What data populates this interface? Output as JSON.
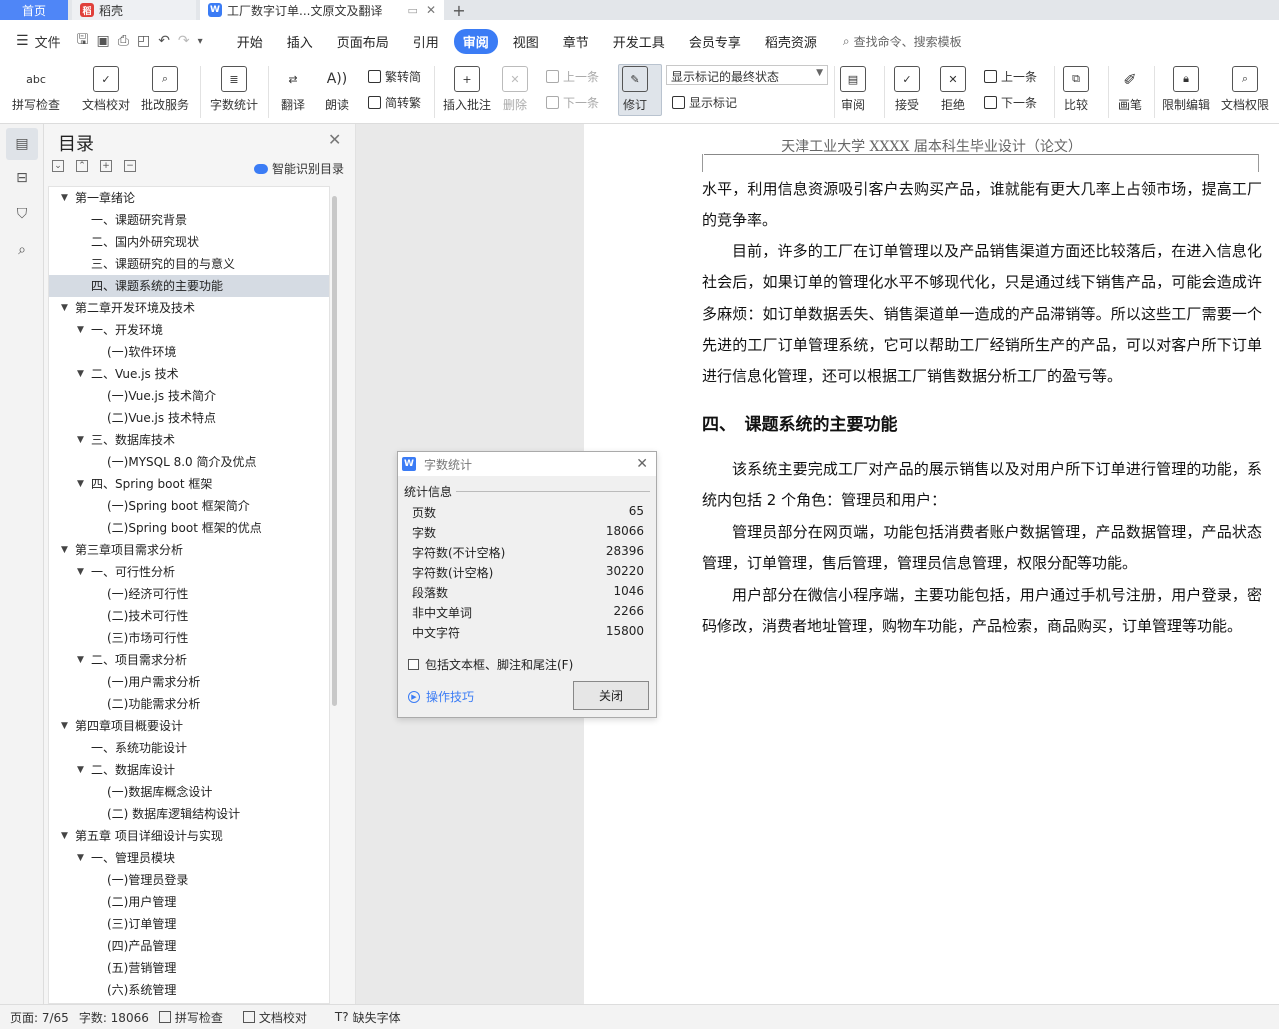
{
  "tabs": {
    "home": "首页",
    "daoke": "稻壳",
    "doc": "工厂数字订单...文原文及翻译"
  },
  "menubar": {
    "file": "文件",
    "items": [
      "开始",
      "插入",
      "页面布局",
      "引用",
      "审阅",
      "视图",
      "章节",
      "开发工具",
      "会员专享",
      "稻壳资源"
    ],
    "active": "审阅",
    "search": "查找命令、搜索模板"
  },
  "ribbon": {
    "spell": "拼写检查",
    "doc_check": "文档校对",
    "batch": "批改服务",
    "word_count": "字数统计",
    "translate": "翻译",
    "read": "朗读",
    "trad": "繁转简",
    "simp": "简转繁",
    "insert_comment": "插入批注",
    "delete": "删除",
    "prev": "上一条",
    "next": "下一条",
    "revise": "修订",
    "display_combo": "显示标记的最终状态",
    "show_marks": "显示标记",
    "review": "审阅",
    "accept": "接受",
    "reject": "拒绝",
    "prev2": "上一条",
    "next2": "下一条",
    "compare": "比较",
    "pen": "画笔",
    "restrict": "限制编辑",
    "perm": "文档权限"
  },
  "toc": {
    "title": "目录",
    "smart": "智能识别目录",
    "items": [
      {
        "text": "第一章绪论",
        "level": 0,
        "caret": true
      },
      {
        "text": "一、课题研究背景",
        "level": 1,
        "caret": false
      },
      {
        "text": "二、国内外研究现状",
        "level": 1,
        "caret": false
      },
      {
        "text": "三、课题研究的目的与意义",
        "level": 1,
        "caret": false
      },
      {
        "text": "四、课题系统的主要功能",
        "level": 1,
        "caret": false,
        "selected": true
      },
      {
        "text": "第二章开发环境及技术",
        "level": 0,
        "caret": true
      },
      {
        "text": "一、开发环境",
        "level": 1,
        "caret": true
      },
      {
        "text": "(一)软件环境",
        "level": 2,
        "caret": false
      },
      {
        "text": "二、Vue.js 技术",
        "level": 1,
        "caret": true
      },
      {
        "text": "(一)Vue.js 技术简介",
        "level": 2,
        "caret": false
      },
      {
        "text": "(二)Vue.js 技术特点",
        "level": 2,
        "caret": false
      },
      {
        "text": "三、数据库技术",
        "level": 1,
        "caret": true
      },
      {
        "text": "(一)MYSQL 8.0 简介及优点",
        "level": 2,
        "caret": false
      },
      {
        "text": "四、Spring boot 框架",
        "level": 1,
        "caret": true
      },
      {
        "text": "(一)Spring boot 框架简介",
        "level": 2,
        "caret": false
      },
      {
        "text": "(二)Spring boot 框架的优点",
        "level": 2,
        "caret": false
      },
      {
        "text": "第三章项目需求分析",
        "level": 0,
        "caret": true
      },
      {
        "text": "一、可行性分析",
        "level": 1,
        "caret": true
      },
      {
        "text": "(一)经济可行性",
        "level": 2,
        "caret": false
      },
      {
        "text": "(二)技术可行性",
        "level": 2,
        "caret": false
      },
      {
        "text": "(三)市场可行性",
        "level": 2,
        "caret": false
      },
      {
        "text": "二、项目需求分析",
        "level": 1,
        "caret": true
      },
      {
        "text": "(一)用户需求分析",
        "level": 2,
        "caret": false
      },
      {
        "text": "(二)功能需求分析",
        "level": 2,
        "caret": false
      },
      {
        "text": "第四章项目概要设计",
        "level": 0,
        "caret": true
      },
      {
        "text": "一、系统功能设计",
        "level": 1,
        "caret": false
      },
      {
        "text": "二、数据库设计",
        "level": 1,
        "caret": true
      },
      {
        "text": "(一)数据库概念设计",
        "level": 2,
        "caret": false
      },
      {
        "text": "(二) 数据库逻辑结构设计",
        "level": 2,
        "caret": false
      },
      {
        "text": "第五章 项目详细设计与实现",
        "level": 0,
        "caret": true
      },
      {
        "text": "一、管理员模块",
        "level": 1,
        "caret": true
      },
      {
        "text": "(一)管理员登录",
        "level": 2,
        "caret": false
      },
      {
        "text": "(二)用户管理",
        "level": 2,
        "caret": false
      },
      {
        "text": "(三)订单管理",
        "level": 2,
        "caret": false
      },
      {
        "text": "(四)产品管理",
        "level": 2,
        "caret": false
      },
      {
        "text": "(五)营销管理",
        "level": 2,
        "caret": false
      },
      {
        "text": "(六)系统管理",
        "level": 2,
        "caret": false
      }
    ]
  },
  "doc": {
    "header": "天津工业大学 XXXX 届本科生毕业设计（论文）",
    "para1": "水平，利用信息资源吸引客户去购买产品，谁就能有更大几率上占领市场，提高工厂的竞争率。",
    "para2": "目前，许多的工厂在订单管理以及产品销售渠道方面还比较落后，在进入信息化社会后，如果订单的管理化水平不够现代化，只是通过线下销售产品，可能会造成许多麻烦：如订单数据丢失、销售渠道单一造成的产品滞销等。所以这些工厂需要一个先进的工厂订单管理系统，它可以帮助工厂经销所生产的产品，可以对客户所下订单进行信息化管理，还可以根据工厂销售数据分析工厂的盈亏等。",
    "heading": "四、　课题系统的主要功能",
    "para3": "该系统主要完成工厂对产品的展示销售以及对用户所下订单进行管理的功能，系统内包括 2 个角色：管理员和用户：",
    "para4": "管理员部分在网页端，功能包括消费者账户数据管理，产品数据管理，产品状态管理，订单管理，售后管理，管理员信息管理，权限分配等功能。",
    "para5": "用户部分在微信小程序端，主要功能包括，用户通过手机号注册，用户登录，密码修改，消费者地址管理，购物车功能，产品检索，商品购买，订单管理等功能。"
  },
  "dialog": {
    "title": "字数统计",
    "section": "统计信息",
    "rows": [
      {
        "label": "页数",
        "value": "65"
      },
      {
        "label": "字数",
        "value": "18066"
      },
      {
        "label": "字符数(不计空格)",
        "value": "28396"
      },
      {
        "label": "字符数(计空格)",
        "value": "30220"
      },
      {
        "label": "段落数",
        "value": "1046"
      },
      {
        "label": "非中文单词",
        "value": "2266"
      },
      {
        "label": "中文字符",
        "value": "15800"
      }
    ],
    "checkbox": "包括文本框、脚注和尾注(F)",
    "tips": "操作技巧",
    "close": "关闭"
  },
  "status": {
    "page": "页面: 7/65",
    "words": "字数: 18066",
    "spell": "拼写检查",
    "check": "文档校对",
    "missing_font": "缺失字体"
  }
}
